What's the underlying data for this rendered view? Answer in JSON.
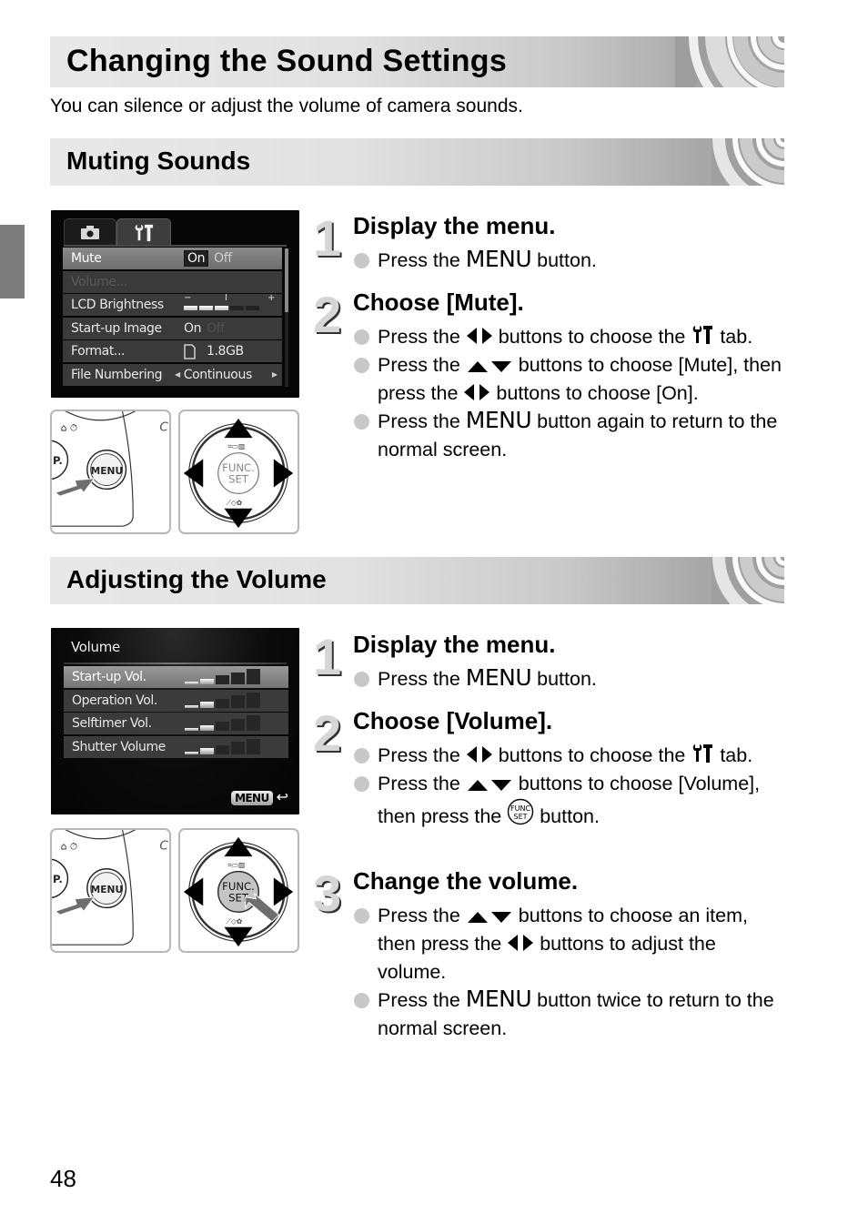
{
  "page": {
    "title": "Changing the Sound Settings",
    "intro": "You can silence or adjust the volume of camera sounds.",
    "page_number": "48",
    "accent_band_color": "#e2e2e2",
    "side_tab_color": "#7d7d7d"
  },
  "sections": [
    {
      "heading": "Muting Sounds",
      "lcd": {
        "tabs": [
          {
            "icon": "camera-icon",
            "active": false
          },
          {
            "icon": "wrench-hammer-icon",
            "active": true
          }
        ],
        "rows": [
          {
            "label": "Mute",
            "value_on": "On",
            "value_off": "Off",
            "selected": true
          },
          {
            "label": "Volume...",
            "dimmed": true
          },
          {
            "label": "LCD Brightness",
            "scale_min": "−",
            "scale_max": "+",
            "scale_mid": "I",
            "level_fraction": 0.6
          },
          {
            "label": "Start-up Image",
            "value_on": "On",
            "value_off": "Off"
          },
          {
            "label": "Format...",
            "value": "1.8GB",
            "icon": "memory-card-icon"
          },
          {
            "label": "File Numbering",
            "value": "Continuous"
          }
        ]
      },
      "illustrations": {
        "left": {
          "button_label": "MENU",
          "side_label": "P."
        },
        "right": {
          "center_label_1": "FUNC.",
          "center_label_2": "SET"
        }
      },
      "steps": [
        {
          "number": "1",
          "title": "Display the menu.",
          "bullets": [
            {
              "pre": "Press the ",
              "key": "MENU",
              "post": " button."
            }
          ]
        },
        {
          "number": "2",
          "title": "Choose [Mute].",
          "bullets": [
            {
              "pre": "Press the ",
              "glyph": "left-right-arrows",
              "mid": " buttons to choose the ",
              "glyph2": "wrench-hammer",
              "post": " tab."
            },
            {
              "pre": "Press the ",
              "glyph": "up-down-arrows",
              "mid": " buttons to choose [Mute], then press the ",
              "glyph2": "left-right-arrows",
              "post": " buttons to choose [On]."
            },
            {
              "pre": "Press the ",
              "key": "MENU",
              "post": " button again to return to the normal screen."
            }
          ]
        }
      ]
    },
    {
      "heading": "Adjusting the Volume",
      "lcd": {
        "title": "Volume",
        "rows": [
          {
            "label": "Start-up Vol.",
            "level": 2,
            "max": 5,
            "selected": true
          },
          {
            "label": "Operation Vol.",
            "level": 2,
            "max": 5
          },
          {
            "label": "Selftimer Vol.",
            "level": 2,
            "max": 5
          },
          {
            "label": "Shutter Volume",
            "level": 2,
            "max": 5
          }
        ],
        "back_label": "MENU"
      },
      "illustrations": {
        "left": {
          "button_label": "MENU",
          "side_label": "P."
        },
        "right": {
          "center_label_1": "FUNC.",
          "center_label_2": "SET"
        }
      },
      "steps": [
        {
          "number": "1",
          "title": "Display the menu.",
          "bullets": [
            {
              "pre": "Press the ",
              "key": "MENU",
              "post": " button."
            }
          ]
        },
        {
          "number": "2",
          "title": "Choose [Volume].",
          "bullets": [
            {
              "pre": "Press the ",
              "glyph": "left-right-arrows",
              "mid": " buttons to choose the ",
              "glyph2": "wrench-hammer",
              "post": " tab."
            },
            {
              "pre": "Press the ",
              "glyph": "up-down-arrows",
              "mid": " buttons to choose [Volume], then press the ",
              "glyph2": "func-set",
              "post": " button."
            }
          ]
        },
        {
          "number": "3",
          "title": "Change the volume.",
          "bullets": [
            {
              "pre": "Press the ",
              "glyph": "up-down-arrows",
              "mid": " buttons to choose an item, then press the ",
              "glyph2": "left-right-arrows",
              "post": " buttons to adjust the volume."
            },
            {
              "pre": "Press the ",
              "key": "MENU",
              "post": " button twice to return to the normal screen."
            }
          ]
        }
      ]
    }
  ]
}
